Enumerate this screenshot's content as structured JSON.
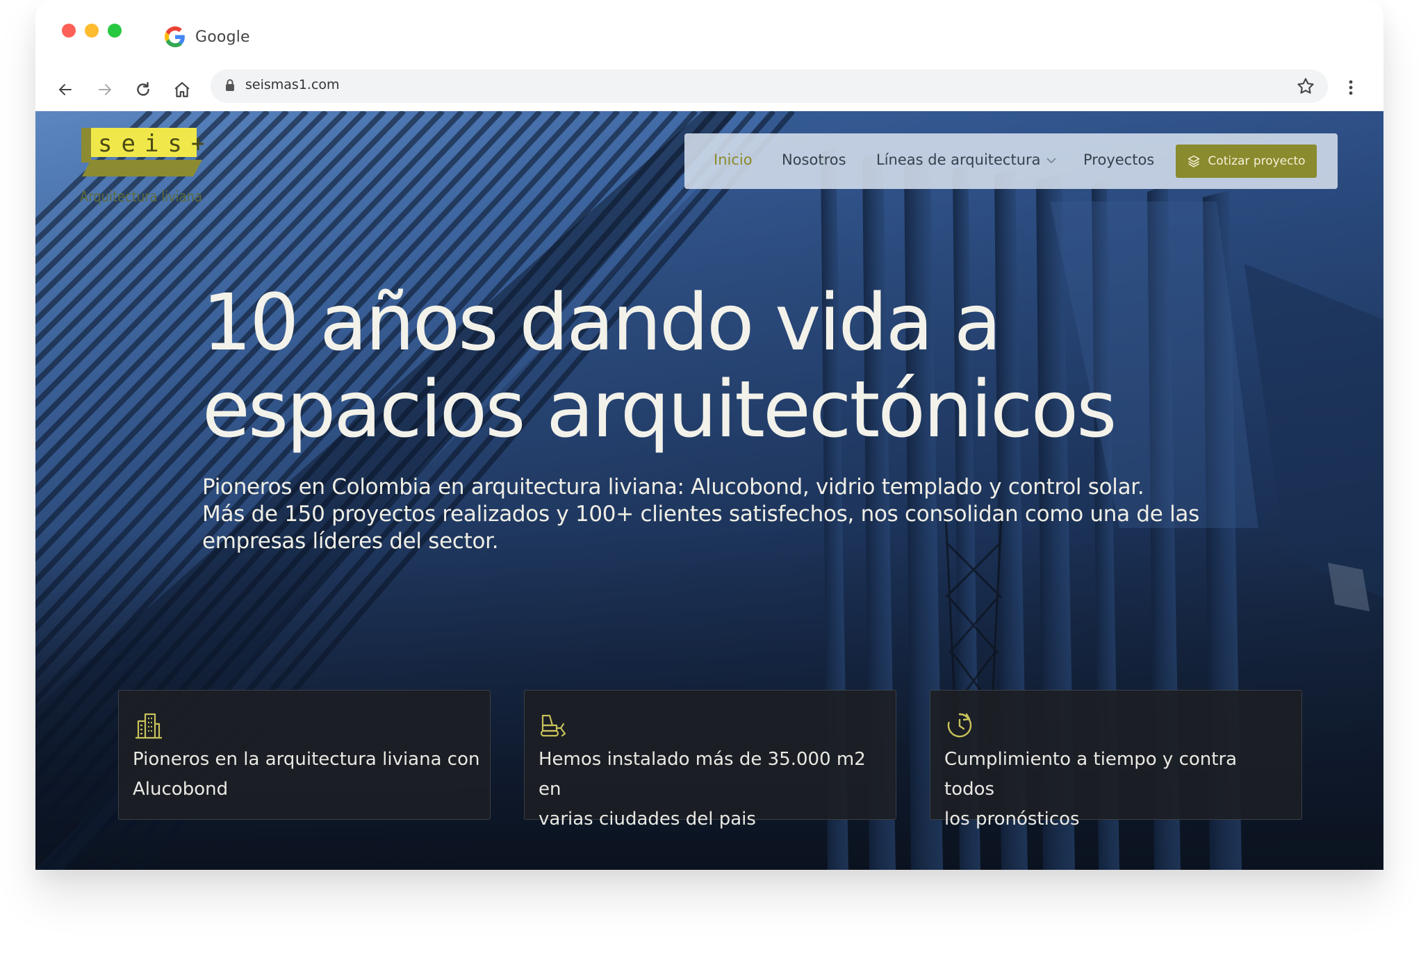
{
  "browser": {
    "tab_title": "Google",
    "url": "seismas1.com"
  },
  "site": {
    "logo": {
      "brand_text": "seis+",
      "tagline": "Arquitectura liviana",
      "colors": {
        "yellow": "#f2ea4a",
        "olive": "#9a9a3a"
      }
    },
    "nav": {
      "items": [
        {
          "label": "Inicio",
          "active": true
        },
        {
          "label": "Nosotros",
          "active": false
        },
        {
          "label": "Líneas de arquitectura",
          "active": false,
          "dropdown": true
        },
        {
          "label": "Proyectos",
          "active": false
        }
      ],
      "cta_label": "Cotizar proyecto",
      "cta_icon": "layers-icon"
    },
    "hero": {
      "title_line1": "10 años dando vida a",
      "title_line2": "espacios arquitectónicos",
      "subtitle_line1": "Pioneros en Colombia en arquitectura liviana: Alucobond, vidrio templado y control solar.",
      "subtitle_line2": "Más de 150 proyectos realizados y 100+ clientes satisfechos, nos consolidan como una de las",
      "subtitle_line3": "empresas líderes del sector."
    },
    "features": [
      {
        "icon": "building-icon",
        "line1": "Pioneros en la arquitectura liviana con",
        "line2": "Alucobond"
      },
      {
        "icon": "bulldozer-icon",
        "line1": "Hemos instalado más de 35.000 m2 en",
        "line2": "varias ciudades del pais"
      },
      {
        "icon": "clock-history-icon",
        "line1": "Cumplimiento a tiempo y contra todos",
        "line2": "los pronósticos"
      }
    ],
    "colors": {
      "accent": "#8a8a2e",
      "icon_accent": "#c9c25a",
      "text_light": "#f3f2ea"
    }
  }
}
